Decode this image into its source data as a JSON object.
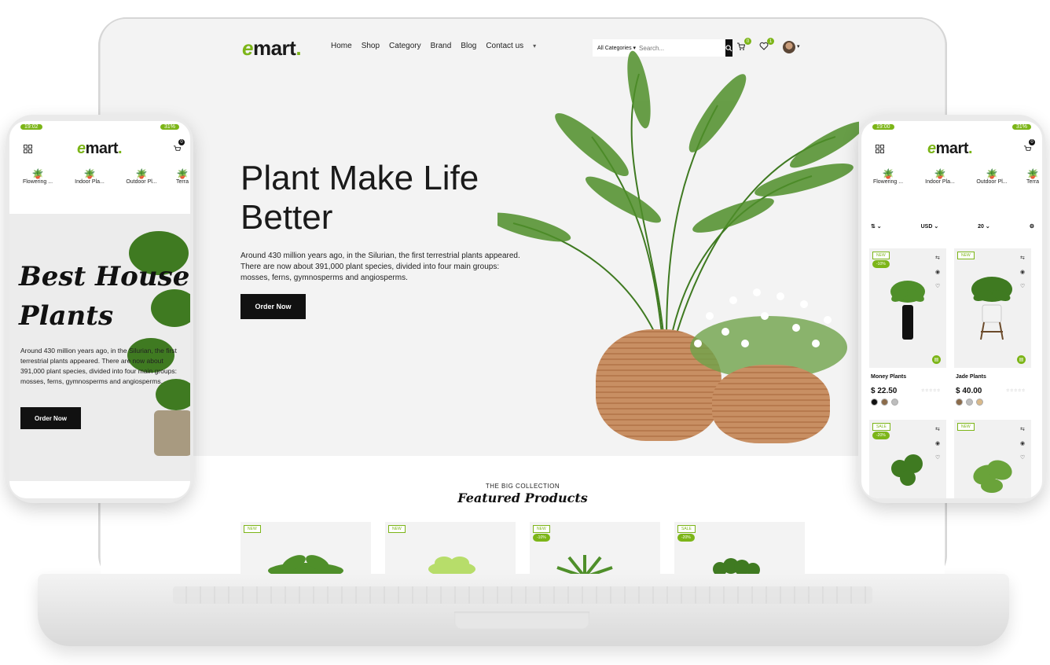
{
  "brand": {
    "logo_e": "e",
    "logo_rest": "mart",
    "logo_dot": "."
  },
  "nav": {
    "items": [
      "Home",
      "Shop",
      "Category",
      "Brand",
      "Blog",
      "Contact us"
    ],
    "more_caret": "▾"
  },
  "search": {
    "category": "All Categories ▾",
    "placeholder": "Search...",
    "button_icon": "search-icon"
  },
  "header": {
    "cart_count": "0",
    "wishlist_count": "1"
  },
  "hero": {
    "title": "Plant Make Life Better",
    "text": "Around 430 million years ago, in the Silurian, the first terrestrial plants appeared. There are now about 391,000 plant species, divided into four main groups: mosses, ferns, gymnosperms and angiosperms.",
    "cta": "Order Now"
  },
  "featured": {
    "eyebrow": "THE BIG COLLECTION",
    "title": "Featured Products",
    "cards": [
      {
        "tag": "NEW",
        "discount": ""
      },
      {
        "tag": "NEW",
        "discount": ""
      },
      {
        "tag": "NEW",
        "discount": "-10%"
      },
      {
        "tag": "SALE",
        "discount": "-20%"
      }
    ]
  },
  "phone_left": {
    "time": "19:02",
    "battery": "31%",
    "cart_count": "0",
    "categories": [
      "Flowering ...",
      "Indoor Pla...",
      "Outdoor Pl...",
      "Terra"
    ],
    "hero_title_line1": "Best House",
    "hero_title_line2": "Plants",
    "hero_text": "Around 430 million years ago, in the Silurian, the first terrestrial plants appeared. There are now about 391,000 plant species, divided into four main groups: mosses, ferns, gymnosperms and angiosperms.",
    "cta": "Order Now"
  },
  "phone_right": {
    "time": "19:00",
    "battery": "31%",
    "cart_count": "0",
    "categories": [
      "Flowering ...",
      "Indoor Pla...",
      "Outdoor Pl...",
      "Terra"
    ],
    "filters": {
      "currency": "USD ⌄",
      "per_page": "20 ⌄"
    },
    "products": [
      {
        "tag": "NEW",
        "discount": "-10%",
        "name": "Money Plants",
        "price": "$ 22.50",
        "stars": "☆☆☆☆☆",
        "colors": [
          "#111111",
          "#8b6b4a",
          "#bdbdbd"
        ]
      },
      {
        "tag": "NEW",
        "discount": "",
        "name": "Jade Plants",
        "price": "$ 40.00",
        "stars": "☆☆☆☆☆",
        "colors": [
          "#8b6b4a",
          "#bdbdbd",
          "#d9b98a"
        ]
      },
      {
        "tag": "SALE",
        "discount": "-20%"
      },
      {
        "tag": "NEW",
        "discount": ""
      }
    ]
  },
  "colors": {
    "accent": "#7cb518",
    "dark": "#111111"
  }
}
